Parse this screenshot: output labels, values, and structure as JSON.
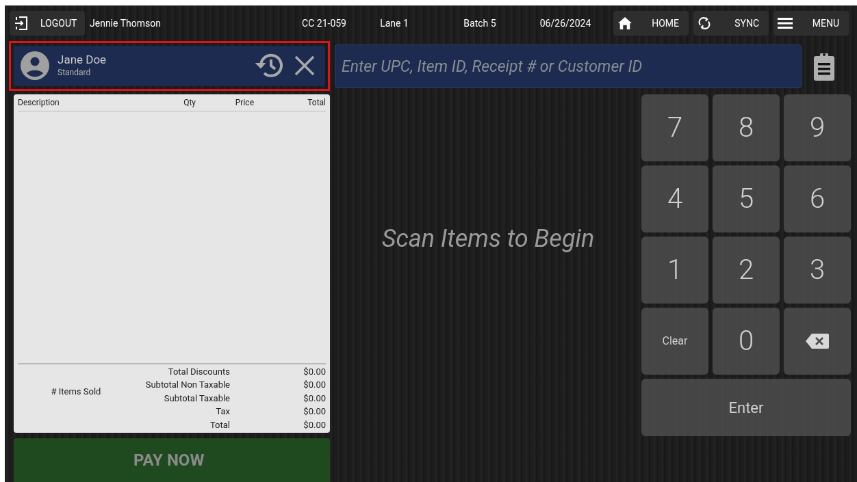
{
  "top_bar": {
    "logout": "LOGOUT",
    "user": "Jennie Thomson",
    "store": "CC 21-059",
    "lane": "Lane 1",
    "batch": "Batch 5",
    "date": "06/26/2024",
    "buttons": [
      {
        "kind": "home",
        "label": "HOME"
      },
      {
        "kind": "sync",
        "label": "SYNC"
      },
      {
        "kind": "menu",
        "label": "MENU"
      }
    ]
  },
  "customer": {
    "name": "Jane Doe",
    "tier": "Standard",
    "highlighted": true
  },
  "search": {
    "placeholder": "Enter UPC, Item ID, Receipt # or Customer ID"
  },
  "table": {
    "columns": [
      "Description",
      "Qty",
      "Price",
      "Total"
    ]
  },
  "summary": {
    "items_sold_label": "# Items Sold",
    "rows": [
      {
        "label": "Total Discounts",
        "value": "$0.00"
      },
      {
        "label": "Subtotal Non Taxable",
        "value": "$0.00"
      },
      {
        "label": "Subtotal Taxable",
        "value": "$0.00"
      },
      {
        "label": "Tax",
        "value": "$0.00"
      },
      {
        "label": "Total",
        "value": "$0.00"
      }
    ]
  },
  "pay_button": {
    "label": "PAY NOW",
    "disabled": true
  },
  "prompt": "Scan Items to Begin",
  "keypad": {
    "keys": [
      {
        "kind": "digit",
        "label": "7"
      },
      {
        "kind": "digit",
        "label": "8"
      },
      {
        "kind": "digit",
        "label": "9"
      },
      {
        "kind": "digit",
        "label": "4"
      },
      {
        "kind": "digit",
        "label": "5"
      },
      {
        "kind": "digit",
        "label": "6"
      },
      {
        "kind": "digit",
        "label": "1"
      },
      {
        "kind": "digit",
        "label": "2"
      },
      {
        "kind": "digit",
        "label": "3"
      },
      {
        "kind": "text",
        "label": "Clear"
      },
      {
        "kind": "digit",
        "label": "0"
      },
      {
        "kind": "backspace"
      }
    ],
    "enter": "Enter"
  }
}
